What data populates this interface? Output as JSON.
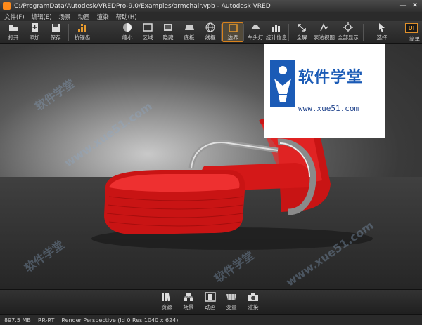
{
  "window": {
    "title": "C:/ProgramData/Autodesk/VREDPro-9.0/Examples/armchair.vpb - Autodesk VRED",
    "minimize": "—",
    "close": "✖"
  },
  "menu": [
    "文件(F)",
    "编辑(E)",
    "场景",
    "动画",
    "渲染",
    "帮助(H)"
  ],
  "toolbar": {
    "open": "打开",
    "add": "添加",
    "save": "保存",
    "antialias": "抗锯齿",
    "zoom": "缩小",
    "region": "区域",
    "hide": "隐藏",
    "floor": "底板",
    "wireframe": "线框",
    "border": "边界",
    "headlight": "车头灯",
    "stats": "统计信息",
    "fullscreen": "全屏",
    "expression_view": "表达视图",
    "show_all": "全部显示",
    "select": "选择",
    "simple": "简单",
    "ui_badge": "UI"
  },
  "watermark": {
    "brand": "软件学堂",
    "url": "www.xue51.com",
    "diagonal": [
      "软件学堂",
      "www.xue51.com",
      "软件学堂",
      "www.xue51.com",
      "软件学堂"
    ]
  },
  "dock": {
    "assets": "资源",
    "scene": "场景",
    "animation": "动画",
    "variants": "变量",
    "render": "渲染"
  },
  "status": {
    "memory": "897.5 MB",
    "mode": "RR-RT",
    "render_info": "Render Perspective (Id 0 Res 1040 x 624)"
  },
  "colors": {
    "accent": "#d9821c",
    "chair": "#d81818",
    "watermark_blue": "#1b5bb6"
  }
}
